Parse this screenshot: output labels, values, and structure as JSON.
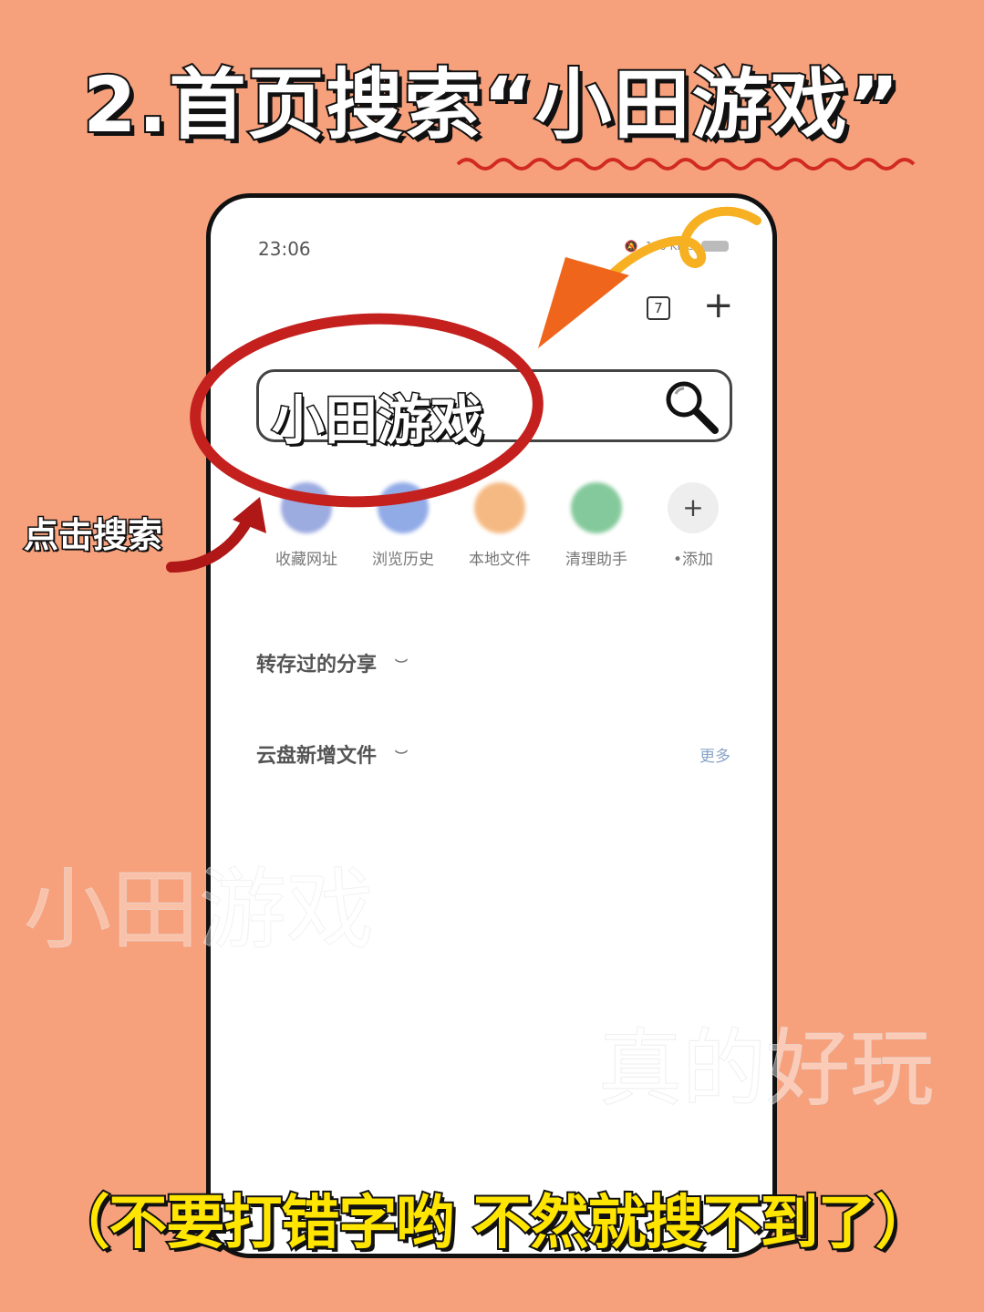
{
  "headline": "2.首页搜索“小田游戏”",
  "status_bar": {
    "time": "23:06",
    "network": "150 KB/s"
  },
  "top_bar": {
    "tab_count": "7",
    "add": "+"
  },
  "search": {
    "value": "小田游戏",
    "icon": "magnifier-icon"
  },
  "quick_actions": [
    {
      "label": "收藏网址",
      "color": "#7b8fd6"
    },
    {
      "label": "浏览历史",
      "color": "#6d8fe0"
    },
    {
      "label": "本地文件",
      "color": "#f2a35a"
    },
    {
      "label": "清理助手",
      "color": "#5cb87a"
    },
    {
      "label": "•添加",
      "symbol": "+",
      "color": "#eeeeee"
    }
  ],
  "sections": [
    {
      "title": "转存过的分享"
    },
    {
      "title": "云盘新增文件",
      "more": "更多"
    }
  ],
  "annotations": {
    "click_label": "点击搜索",
    "warning": "（不要打错字哟 不然就搜不到了）"
  },
  "watermarks": [
    "小田游戏",
    "真的好玩"
  ],
  "colors": {
    "background": "#f7a07c",
    "warning_text": "#ffe500",
    "circle": "#c4201e",
    "arrow": "#f47a1e"
  }
}
